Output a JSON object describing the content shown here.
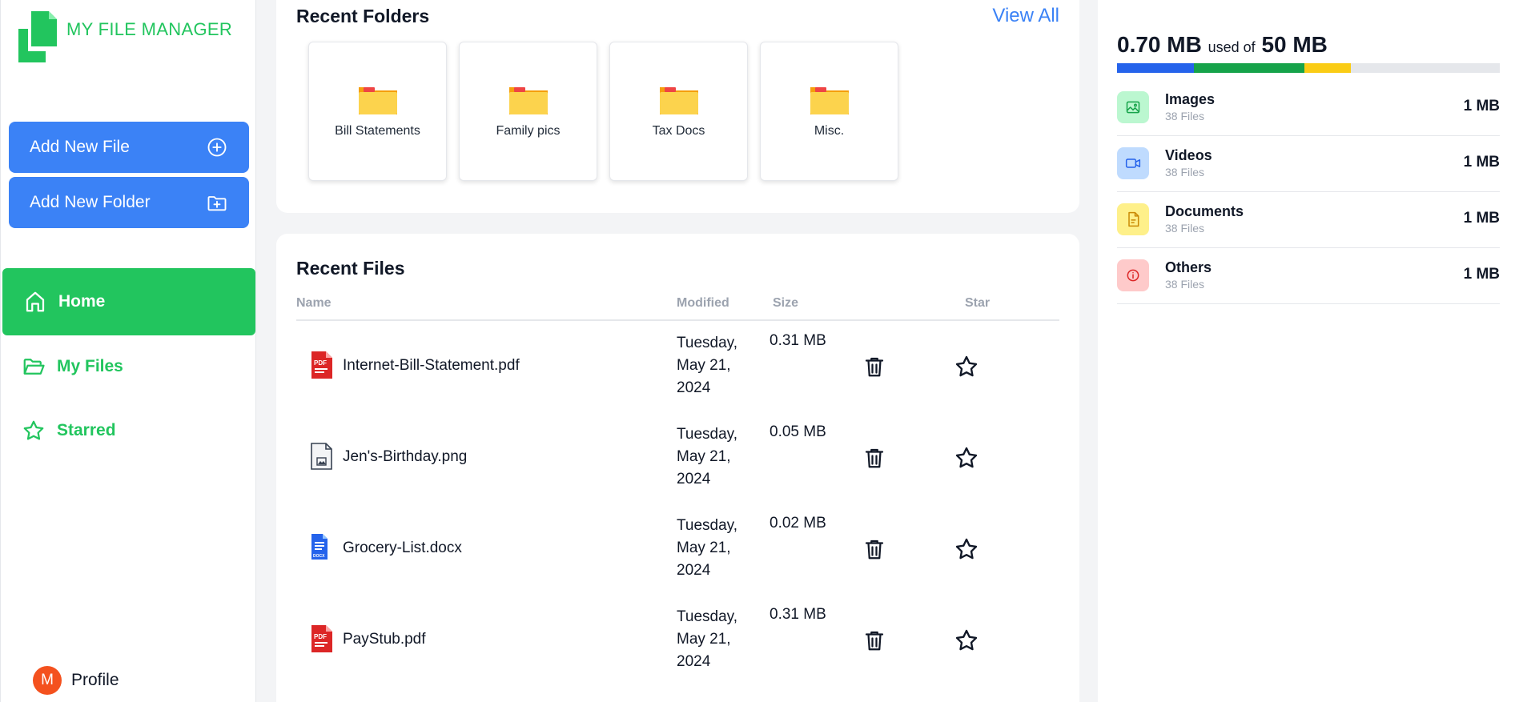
{
  "app": {
    "title": "MY FILE MANAGER"
  },
  "sidebar": {
    "add_file": "Add New File",
    "add_folder": "Add New Folder",
    "nav": [
      {
        "label": "Home",
        "icon": "home-icon",
        "active": true
      },
      {
        "label": "My Files",
        "icon": "folder-open-icon",
        "active": false
      },
      {
        "label": "Starred",
        "icon": "star-icon",
        "active": false
      }
    ],
    "profile": {
      "initial": "M",
      "label": "Profile"
    }
  },
  "recent_folders": {
    "title": "Recent Folders",
    "view_all": "View All",
    "folders": [
      "Bill Statements",
      "Family pics",
      "Tax Docs",
      "Misc."
    ]
  },
  "recent_files": {
    "title": "Recent Files",
    "columns": [
      "Name",
      "Modified",
      "Size",
      "Star"
    ],
    "rows": [
      {
        "name": "Internet-Bill-Statement.pdf",
        "type": "pdf",
        "modified": [
          "Tuesday,",
          "May 21,",
          "2024"
        ],
        "size": "0.31 MB"
      },
      {
        "name": "Jen's-Birthday.png",
        "type": "image",
        "modified": [
          "Tuesday,",
          "May 21,",
          "2024"
        ],
        "size": "0.05 MB"
      },
      {
        "name": "Grocery-List.docx",
        "type": "docx",
        "modified": [
          "Tuesday,",
          "May 21,",
          "2024"
        ],
        "size": "0.02 MB"
      },
      {
        "name": "PayStub.pdf",
        "type": "pdf",
        "modified": [
          "Tuesday,",
          "May 21,",
          "2024"
        ],
        "size": "0.31 MB"
      }
    ]
  },
  "storage": {
    "used": "0.70 MB",
    "used_of": "used of",
    "total": "50 MB",
    "bar_segments": [
      {
        "color": "#2563eb",
        "fraction": 0.2
      },
      {
        "color": "#16a34a",
        "fraction": 0.29
      },
      {
        "color": "#facc15",
        "fraction": 0.12
      }
    ],
    "categories": [
      {
        "name": "Images",
        "count": "38 Files",
        "size": "1 MB",
        "icon": "image-icon",
        "bg": "#bbf7d0",
        "fg": "#16a34a"
      },
      {
        "name": "Videos",
        "count": "38 Files",
        "size": "1 MB",
        "icon": "video-icon",
        "bg": "#bfdbfe",
        "fg": "#2563eb"
      },
      {
        "name": "Documents",
        "count": "38 Files",
        "size": "1 MB",
        "icon": "document-icon",
        "bg": "#fef08a",
        "fg": "#ca8a04"
      },
      {
        "name": "Others",
        "count": "38 Files",
        "size": "1 MB",
        "icon": "info-icon",
        "bg": "#fecaca",
        "fg": "#dc2626"
      }
    ]
  },
  "colors": {
    "brand_green": "#22c55e",
    "primary_blue": "#3b82f6"
  }
}
